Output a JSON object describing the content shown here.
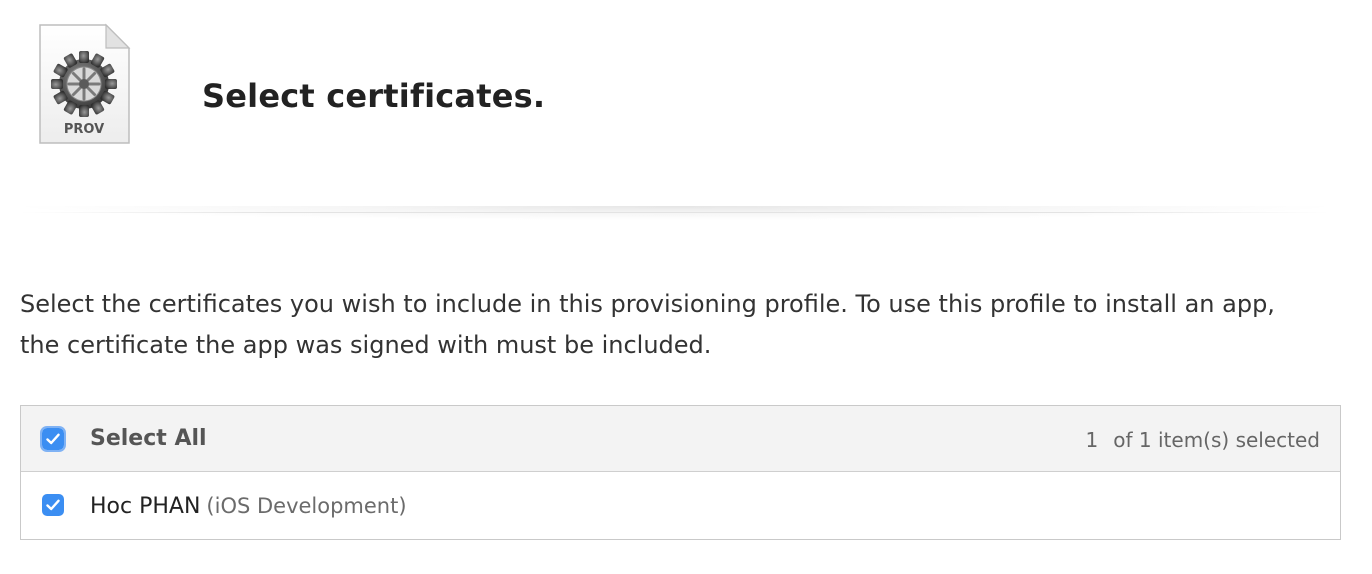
{
  "header": {
    "icon_label": "PROV",
    "title": "Select certificates."
  },
  "description": "Select the certificates you wish to include in this provisioning profile. To use this profile to install an app, the certificate the app was signed with must be included.",
  "list": {
    "select_all": {
      "label": "Select All",
      "checked": true
    },
    "selection_count": {
      "selected": "1",
      "suffix": "of 1 item(s) selected"
    },
    "items": [
      {
        "name": "Hoc PHAN",
        "type": "(iOS Development)",
        "checked": true
      }
    ]
  },
  "colors": {
    "checkbox_blue": "#3b8ef2",
    "header_bg": "#f3f3f3",
    "border": "#c9c9c9"
  }
}
